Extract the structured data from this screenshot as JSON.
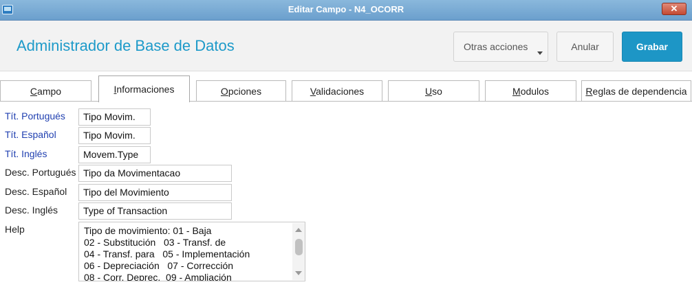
{
  "window": {
    "title": "Editar Campo - N4_OCORR",
    "close_glyph": "✕"
  },
  "header": {
    "app_title": "Administrador de Base de Datos",
    "buttons": {
      "otras_acciones": "Otras acciones",
      "anular": "Anular",
      "grabar": "Grabar"
    }
  },
  "tabs": [
    {
      "first": "C",
      "rest": "ampo"
    },
    {
      "first": "I",
      "rest": "nformaciones"
    },
    {
      "first": "O",
      "rest": "pciones"
    },
    {
      "first": "V",
      "rest": "alidaciones"
    },
    {
      "first": "U",
      "rest": "so"
    },
    {
      "first": "M",
      "rest": "odulos"
    },
    {
      "first": "R",
      "rest": "eglas de dependencia"
    }
  ],
  "active_tab": "Informaciones",
  "form": {
    "tit_portugues": {
      "label": "Tít. Portugués",
      "value": "Tipo Movim."
    },
    "tit_espanol": {
      "label": "Tít. Español",
      "value": "Tipo Movim."
    },
    "tit_ingles": {
      "label": "Tít. Inglés",
      "value": "Movem.Type"
    },
    "desc_portugues": {
      "label": "Desc. Portugués",
      "value": "Tipo da Movimentacao"
    },
    "desc_espanol": {
      "label": "Desc. Español",
      "value": "Tipo del Movimiento"
    },
    "desc_ingles": {
      "label": "Desc. Inglés",
      "value": "Type of Transaction"
    },
    "help": {
      "label": "Help",
      "lines": [
        "Tipo de movimiento: 01 - Baja",
        "02 - Substitución   03 - Transf. de",
        "04 - Transf. para   05 - Implementación",
        "06 - Depreciación   07 - Corrección",
        "08 - Corr. Deprec.  09 - Ampliación"
      ]
    }
  },
  "colors": {
    "accent": "#1d96c6",
    "title_text": "#1d9ac9",
    "label_blue": "#1f3fb0"
  }
}
